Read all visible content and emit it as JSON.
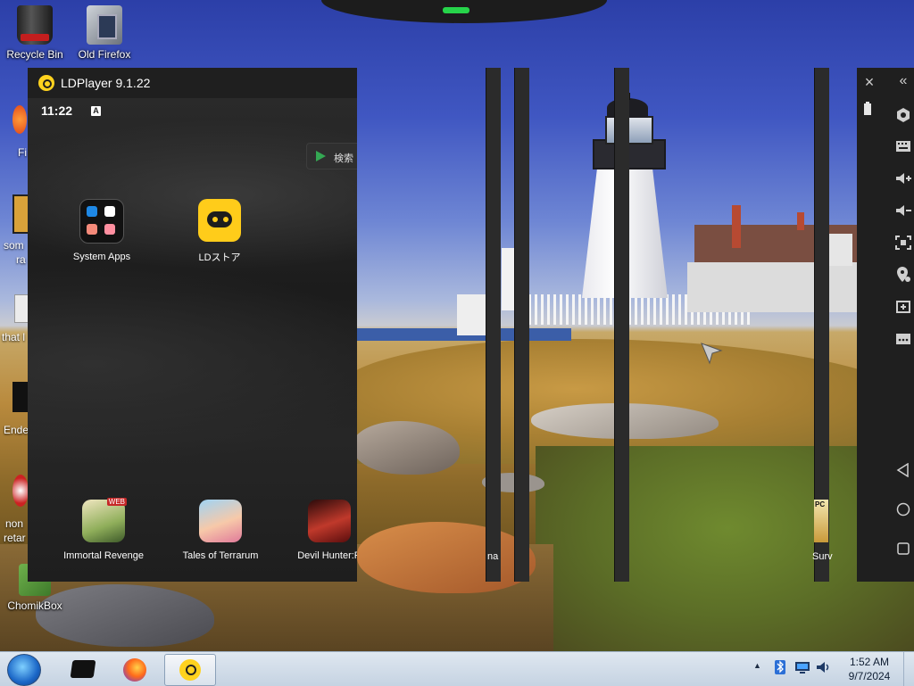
{
  "desktop": {
    "icons": [
      {
        "label": "Recycle Bin"
      },
      {
        "label": "Old Firefox"
      },
      {
        "label": "ChomikBox"
      }
    ],
    "cut_labels": [
      "Fi",
      "som",
      "ra",
      "that l",
      "Ende",
      "non",
      "retar"
    ]
  },
  "ldplayer": {
    "title": "LDPlayer 9.1.22",
    "status_time": "11:22",
    "status_badge": "A",
    "search_label": "検索",
    "apps": [
      {
        "label": "System Apps"
      },
      {
        "label": "LDストア"
      },
      {
        "label": "Immortal Revenge",
        "tag": "WEB"
      },
      {
        "label": "Tales of Terrarum"
      },
      {
        "label": "Devil Hunter:R"
      }
    ],
    "partial_labels": [
      "na",
      "Surv",
      "PC"
    ],
    "toolbar": {
      "close": "×",
      "collapse": "«",
      "buttons": [
        "settings-icon",
        "keyboard-icon",
        "volume-up-icon",
        "volume-down-icon",
        "fullscreen-icon",
        "location-icon",
        "add-window-icon",
        "more-icon"
      ],
      "nav": [
        "back-icon",
        "home-icon",
        "recent-icon"
      ]
    }
  },
  "taskbar": {
    "time": "1:52 AM",
    "date": "9/7/2024",
    "tray_arrow": "▲"
  }
}
